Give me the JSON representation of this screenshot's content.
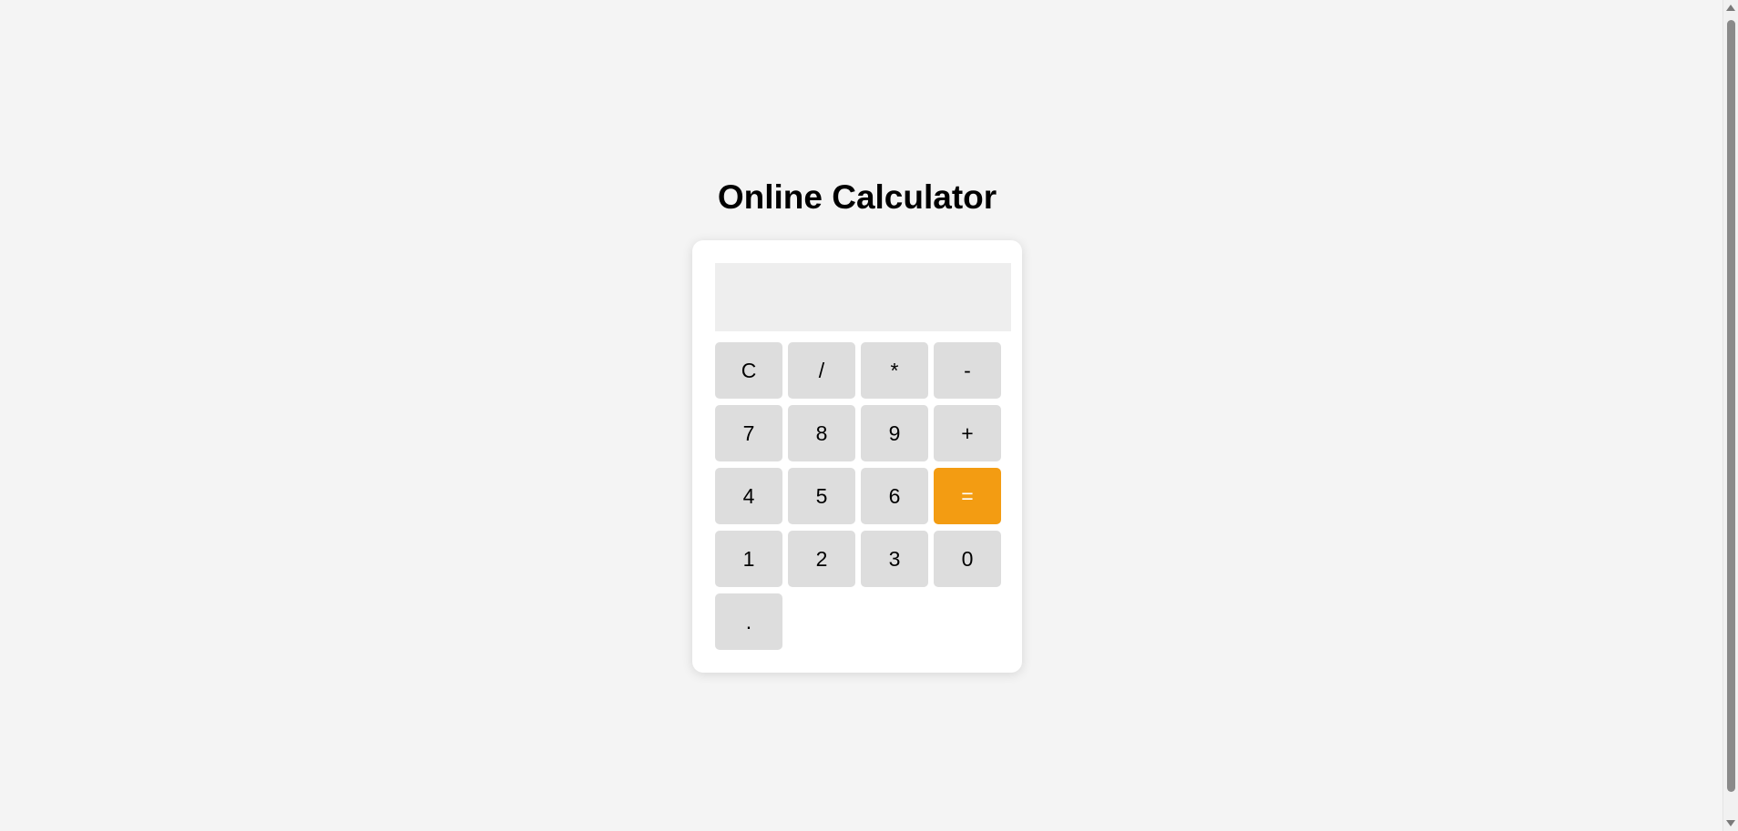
{
  "page": {
    "title": "Online Calculator"
  },
  "display": {
    "value": ""
  },
  "keys": [
    {
      "label": "C",
      "name": "clear-button"
    },
    {
      "label": "/",
      "name": "divide-button"
    },
    {
      "label": "*",
      "name": "multiply-button"
    },
    {
      "label": "-",
      "name": "subtract-button"
    },
    {
      "label": "7",
      "name": "digit-7-button"
    },
    {
      "label": "8",
      "name": "digit-8-button"
    },
    {
      "label": "9",
      "name": "digit-9-button"
    },
    {
      "label": "+",
      "name": "add-button"
    },
    {
      "label": "4",
      "name": "digit-4-button"
    },
    {
      "label": "5",
      "name": "digit-5-button"
    },
    {
      "label": "6",
      "name": "digit-6-button"
    },
    {
      "label": "=",
      "name": "equals-button"
    },
    {
      "label": "1",
      "name": "digit-1-button"
    },
    {
      "label": "2",
      "name": "digit-2-button"
    },
    {
      "label": "3",
      "name": "digit-3-button"
    },
    {
      "label": "0",
      "name": "digit-0-button"
    },
    {
      "label": ".",
      "name": "decimal-button"
    }
  ],
  "colors": {
    "page_background": "#f4f4f4",
    "card_background": "#ffffff",
    "display_background": "#eeeeee",
    "key_background": "#dddddd",
    "equals_background": "#f39c12",
    "equals_text": "#ffffff"
  }
}
